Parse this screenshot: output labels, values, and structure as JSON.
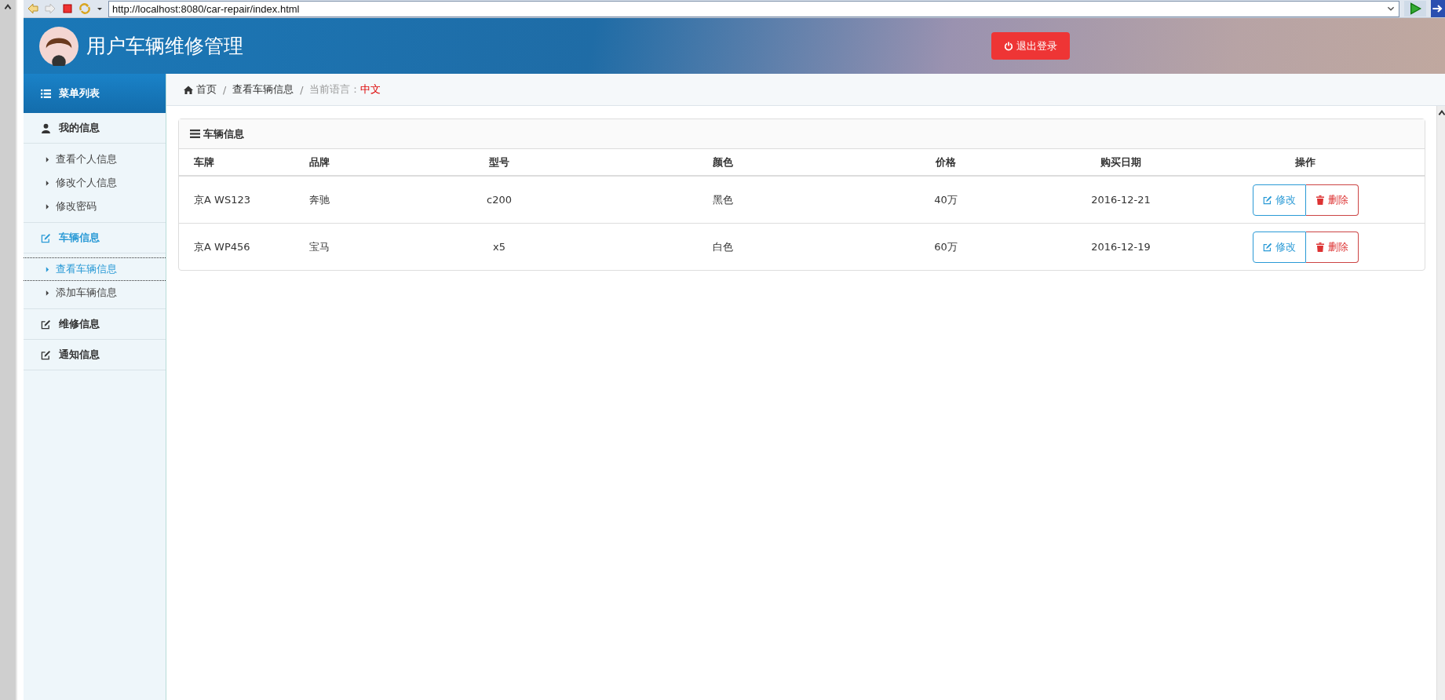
{
  "browser": {
    "url": "http://localhost:8080/car-repair/index.html"
  },
  "header": {
    "title": "用户车辆维修管理",
    "logout_button": "退出登录"
  },
  "sidebar": {
    "title": "菜单列表",
    "groups": [
      {
        "label": "我的信息",
        "kind": "user",
        "active": false,
        "children": [
          {
            "label": "查看个人信息",
            "selected": false
          },
          {
            "label": "修改个人信息",
            "selected": false
          },
          {
            "label": "修改密码",
            "selected": false
          }
        ]
      },
      {
        "label": "车辆信息",
        "kind": "edit",
        "active": true,
        "children": [
          {
            "label": "查看车辆信息",
            "selected": true
          },
          {
            "label": "添加车辆信息",
            "selected": false
          }
        ]
      },
      {
        "label": "维修信息",
        "kind": "edit",
        "active": false
      },
      {
        "label": "通知信息",
        "kind": "edit",
        "active": false
      }
    ]
  },
  "breadcrumb": {
    "items": [
      "首页",
      "查看车辆信息"
    ],
    "separator": "/",
    "language_label": "当前语言：",
    "language": "中文"
  },
  "panel": {
    "title": "车辆信息",
    "table": {
      "columns": [
        "车牌",
        "品牌",
        "型号",
        "颜色",
        "价格",
        "购买日期",
        "操作"
      ],
      "rows": [
        {
          "cells": [
            "京A WS123",
            "奔驰",
            "c200",
            "黑色",
            "40万",
            "2016-12-21"
          ],
          "actions": [
            {
              "kind": "edit",
              "label": "修改"
            },
            {
              "kind": "delete",
              "label": "删除"
            }
          ]
        },
        {
          "cells": [
            "京A WP456",
            "宝马",
            "x5",
            "白色",
            "60万",
            "2016-12-19"
          ],
          "actions": [
            {
              "kind": "edit",
              "label": "修改"
            },
            {
              "kind": "delete",
              "label": "删除"
            }
          ]
        }
      ]
    }
  }
}
